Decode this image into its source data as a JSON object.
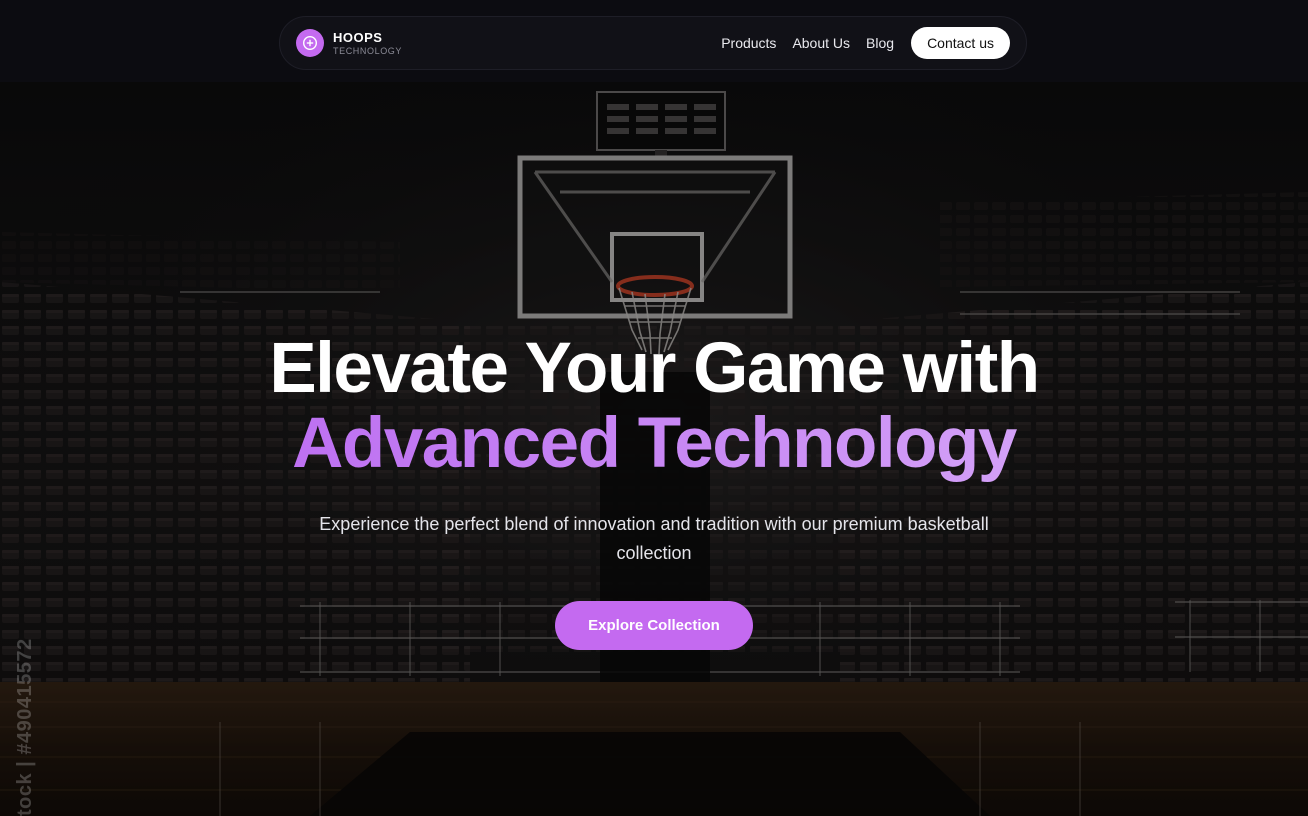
{
  "colors": {
    "accent": "#c46af0",
    "background": "#0c0c11",
    "headline_gradient": [
      "#b65ff0",
      "#ddb6fb"
    ]
  },
  "navbar": {
    "brand_name": "HOOPS",
    "brand_sub": "TECHNOLOGY",
    "logo_icon": "plus-circle-icon",
    "links": [
      "Products",
      "About Us",
      "Blog"
    ],
    "contact_label": "Contact us"
  },
  "hero": {
    "headline_line1": "Elevate Your Game with",
    "headline_line2": "Advanced Technology",
    "subtitle": "Experience the perfect blend of innovation and tradition with our premium basketball collection",
    "cta_label": "Explore Collection"
  },
  "watermark": {
    "side_text": "tock | #490415572"
  }
}
